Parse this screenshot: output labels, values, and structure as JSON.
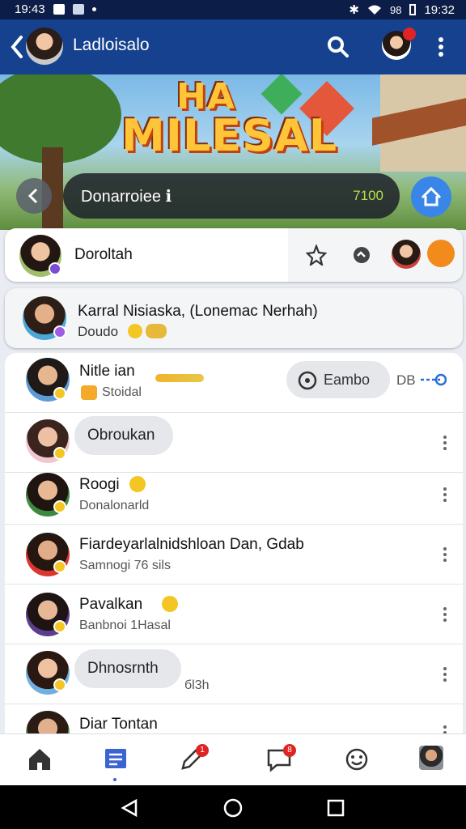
{
  "status_bar": {
    "time_left": "19:43",
    "battery": "98",
    "time_right": "19:32"
  },
  "app_bar": {
    "title": "Ladloisalo"
  },
  "banner": {
    "title_line1": "HA",
    "title_line2": "MILESAL"
  },
  "search_pill": {
    "text": "Donarroiee ℹ",
    "value": "7100"
  },
  "header_card": {
    "name": "Doroltah"
  },
  "pinned": {
    "name": "Karral Nisiaska, (Lonemac Nerhah)",
    "sub": "Doudo"
  },
  "rows": [
    {
      "name": "Nitle ian",
      "sub": "Stoidal",
      "chip": "Eambo",
      "chip_extra": "DB"
    },
    {
      "bubble": "Obroukan"
    },
    {
      "name": "Roogi",
      "sub": "Donalonarld"
    },
    {
      "name": "Fiardeyarlalnidshloan Dan, Gdab",
      "sub": "Samnogi 76 sils"
    },
    {
      "name": "Pavalkan",
      "sub": "Banbnoi 1Hasal"
    },
    {
      "bubble": "Dhnosrnth",
      "sub": "бl3h"
    },
    {
      "name": "Diar Tontan"
    }
  ],
  "bottom_nav": {
    "badge_pencil": "1",
    "badge_chat": "8"
  },
  "colors": {
    "appbar": "#15418f",
    "statusbar": "#0c1d47",
    "accent": "#3a86e8",
    "badge": "#e02424"
  }
}
